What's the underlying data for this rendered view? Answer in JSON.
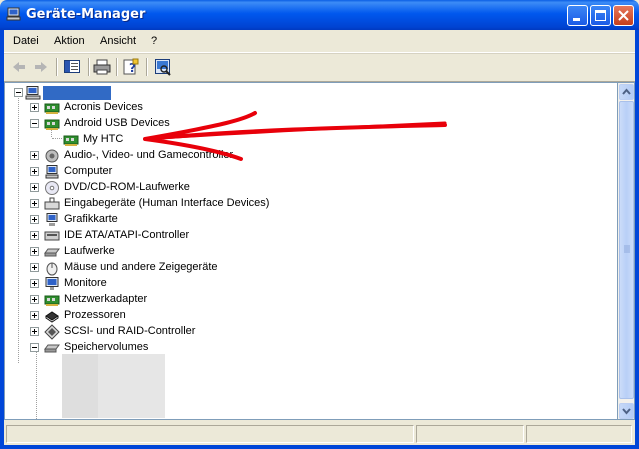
{
  "window": {
    "title": "Geräte-Manager"
  },
  "menu": [
    "Datei",
    "Aktion",
    "Ansicht",
    "?"
  ],
  "tree": {
    "items": [
      {
        "label": "Acronis Devices",
        "icon": "network-card-icon",
        "expanded": false
      },
      {
        "label": "Android USB Devices",
        "icon": "usb-device-icon",
        "expanded": true
      },
      {
        "label": "My HTC",
        "icon": "usb-device-icon",
        "child": true
      },
      {
        "label": "Audio-, Video- und Gamecontroller",
        "icon": "speaker-icon",
        "expanded": false
      },
      {
        "label": "Computer",
        "icon": "computer-icon",
        "expanded": false
      },
      {
        "label": "DVD/CD-ROM-Laufwerke",
        "icon": "cd-drive-icon",
        "expanded": false
      },
      {
        "label": "Eingabegeräte (Human Interface Devices)",
        "icon": "hid-icon",
        "expanded": false
      },
      {
        "label": "Grafikkarte",
        "icon": "display-adapter-icon",
        "expanded": false
      },
      {
        "label": "IDE ATA/ATAPI-Controller",
        "icon": "ide-controller-icon",
        "expanded": false
      },
      {
        "label": "Laufwerke",
        "icon": "disk-drive-icon",
        "expanded": false
      },
      {
        "label": "Mäuse und andere Zeigegeräte",
        "icon": "mouse-icon",
        "expanded": false
      },
      {
        "label": "Monitore",
        "icon": "monitor-icon",
        "expanded": false
      },
      {
        "label": "Netzwerkadapter",
        "icon": "network-card-icon",
        "expanded": false
      },
      {
        "label": "Prozessoren",
        "icon": "processor-icon",
        "expanded": false
      },
      {
        "label": "SCSI- und RAID-Controller",
        "icon": "scsi-icon",
        "expanded": false
      },
      {
        "label": "Speichervolumes",
        "icon": "storage-volume-icon",
        "expanded": true
      }
    ]
  },
  "annotation": {
    "color": "#e8000a",
    "description": "arrow"
  },
  "colors": {
    "titlebar": "#0058ee",
    "selection": "#316ac5"
  }
}
